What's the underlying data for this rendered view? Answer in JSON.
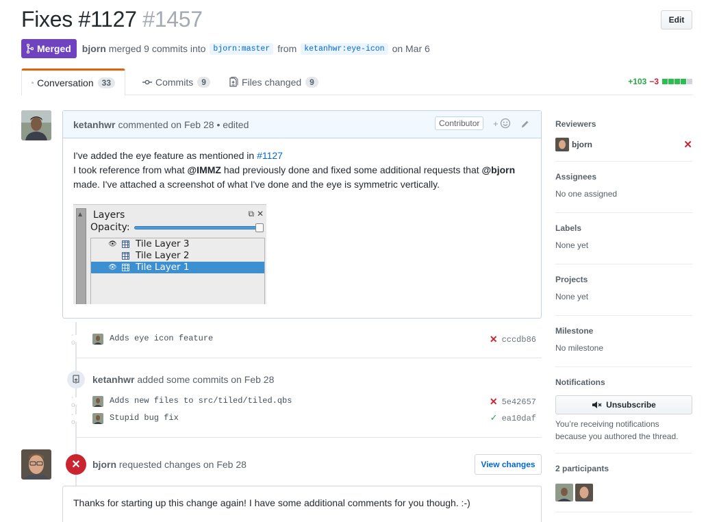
{
  "pr": {
    "title": "Fixes #1127",
    "number": "#1457",
    "edit_label": "Edit",
    "state": "Merged",
    "author": "bjorn",
    "merged_text": "merged 9 commits into",
    "base_ref": "bjorn:master",
    "from_word": "from",
    "head_ref": "ketanhwr:eye-icon",
    "date_text": "on Mar 6"
  },
  "tabs": [
    {
      "label": "Conversation",
      "count": "33",
      "icon": "comment-discussion-icon"
    },
    {
      "label": "Commits",
      "count": "9",
      "icon": "git-commit-icon"
    },
    {
      "label": "Files changed",
      "count": "9",
      "icon": "diff-icon"
    }
  ],
  "diffstat": {
    "additions": "+103",
    "deletions": "−3",
    "green_blocks": 4,
    "total_blocks": 5
  },
  "comment": {
    "author": "ketanhwr",
    "meta": "commented on Feb 28 • edited",
    "badge": "Contributor",
    "line1_text": "I've added the eye feature as mentioned in ",
    "line1_link": "#1127",
    "line2_a": "I took reference from what ",
    "mention1": "@IMMZ",
    "line2_b": " had previously done and fixed some additional requests that ",
    "mention2": "@bjorn",
    "line3": "made. I've attached a screenshot of what I've done and the eye is symmetric vertically.",
    "screenshot": {
      "panel_title": "Layers",
      "opacity_label": "Opacity:",
      "layers": [
        "Tile Layer 3",
        "Tile Layer 2",
        "Tile Layer 1"
      ]
    }
  },
  "commits_a": [
    {
      "message": "Adds eye icon feature",
      "sha": "cccdb86",
      "status": "fail"
    }
  ],
  "push_event": {
    "author": "ketanhwr",
    "text": "added some commits on Feb 28"
  },
  "commits_b": [
    {
      "message": "Adds new files to src/tiled/tiled.qbs",
      "sha": "5e42657",
      "status": "fail"
    },
    {
      "message": "Stupid bug fix",
      "sha": "ea10daf",
      "status": "success"
    }
  ],
  "review": {
    "author": "bjorn",
    "text": "requested changes on Feb 28",
    "button": "View changes",
    "body": "Thanks for starting up this change again! I have some additional comments for you though. :-)"
  },
  "sidebar": {
    "reviewers_h": "Reviewers",
    "reviewer": "bjorn",
    "assignees_h": "Assignees",
    "assignees_v": "No one assigned",
    "labels_h": "Labels",
    "labels_v": "None yet",
    "projects_h": "Projects",
    "projects_v": "None yet",
    "milestone_h": "Milestone",
    "milestone_v": "No milestone",
    "notifications_h": "Notifications",
    "unsubscribe": "Unsubscribe",
    "notif_text": "You’re receiving notifications because you authored the thread.",
    "participants_h": "2 participants"
  },
  "colors": {
    "merged": "#6f42c1",
    "link": "#0366d6",
    "fail": "#cb2431",
    "success": "#28a745"
  }
}
